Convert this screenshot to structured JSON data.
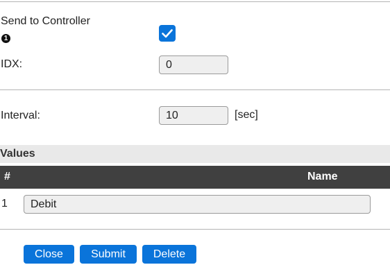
{
  "send_to_controller": {
    "label": "Send to Controller",
    "badge": "1",
    "checked": true
  },
  "idx": {
    "label": "IDX:",
    "value": "0"
  },
  "interval": {
    "label": "Interval:",
    "value": "10",
    "unit": "[sec]"
  },
  "values": {
    "title": "Values",
    "columns": [
      "#",
      "Name"
    ],
    "rows": [
      {
        "num": "1",
        "name": "Debit"
      }
    ]
  },
  "buttons": {
    "close": "Close",
    "submit": "Submit",
    "delete": "Delete"
  },
  "colors": {
    "accent": "#0a74da",
    "table_header": "#404040",
    "section_bg": "#e9e9e9"
  }
}
